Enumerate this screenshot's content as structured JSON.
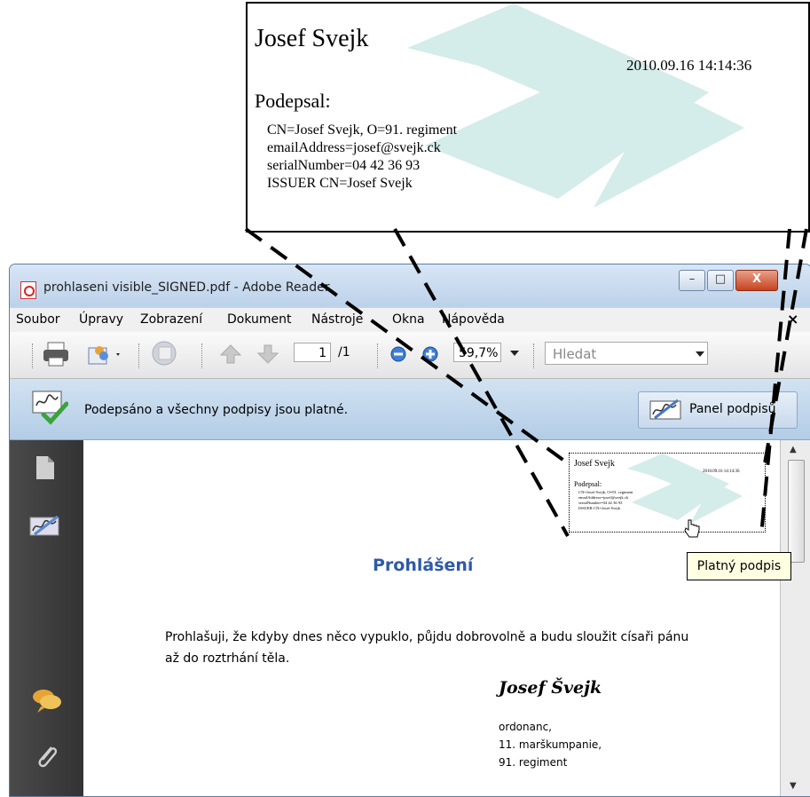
{
  "zoom_callout": {
    "name": "Josef Svejk",
    "date": "2010.09.16 14:14:36",
    "signed_heading": "Podepsal:",
    "lines": [
      "CN=Josef Svejk, O=91. regiment",
      "emailAddress=josef@svejk.ck",
      "serialNumber=04 42 36 93",
      "ISSUER CN=Josef Svejk"
    ]
  },
  "window": {
    "title": "prohlaseni visible_SIGNED.pdf - Adobe Reader",
    "controls": {
      "minimize": "–",
      "maximize": "□",
      "close": "X"
    }
  },
  "menu": {
    "items": [
      "Soubor",
      "Úpravy",
      "Zobrazení",
      "Dokument",
      "Nástroje",
      "Okna",
      "Nápověda"
    ],
    "close": "×"
  },
  "toolbar": {
    "page_current": "1",
    "page_total": "/1",
    "zoom": "59,7%",
    "search_placeholder": "Hledat",
    "icons": [
      "print-icon",
      "share-icon",
      "sign-icon",
      "prev-page-icon",
      "next-page-icon",
      "zoom-out-icon",
      "zoom-in-icon"
    ]
  },
  "signature_bar": {
    "status": "Podepsáno a všechny podpisy jsou platné.",
    "panel_button": "Panel podpisů"
  },
  "left_panel": {
    "icons": [
      "pages-icon",
      "signatures-icon",
      "comments-icon",
      "attachments-icon"
    ]
  },
  "document": {
    "mini_signature": {
      "name": "Josef Svejk",
      "date": "2010.09.16 14:14:36",
      "signed_heading": "Podepsal:",
      "lines": [
        "CN=Josef Svejk, O=91. regiment",
        "emailAddress=josef@svejk.ck",
        "serialNumber=04 42 36 93",
        "ISSUER CN=Josef Svejk"
      ]
    },
    "tooltip": "Platný podpis",
    "title": "Prohlášení",
    "body": "Prohlašuji, že kdyby dnes něco vypuklo, půjdu dobrovolně a budu sloužit císaři pánu až do roztrhání těla.",
    "signature": "Josef Švejk",
    "signer_lines": [
      "ordonanc,",
      "11. marškumpanie,",
      "91. regiment"
    ]
  },
  "colors": {
    "title_blue": "#2e5aa8",
    "watermark": "#cfe7e6",
    "sigbar": "#b3cde6"
  }
}
